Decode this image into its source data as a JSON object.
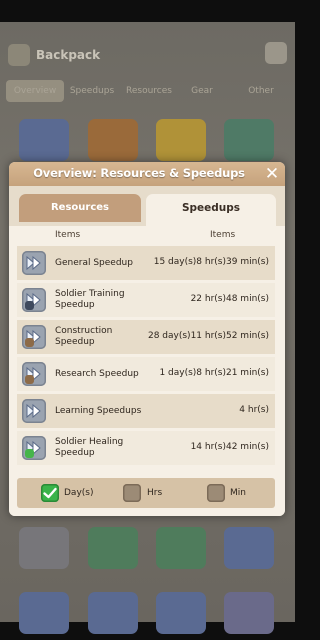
{
  "background": {
    "title": "Backpack",
    "tabs": [
      "Overview",
      "Speedups",
      "Resources",
      "Gear",
      "Other"
    ]
  },
  "modal": {
    "title": "Overview: Resources & Speedups",
    "close_glyph": "✕",
    "tabs": [
      {
        "label": "Resources",
        "active": false
      },
      {
        "label": "Speedups",
        "active": true
      }
    ],
    "columns": [
      "Items",
      "Items"
    ],
    "rows": [
      {
        "name": "General Speedup",
        "time": "15 day(s)8 hr(s)39 min(s)",
        "icon": "speedup-arrows-icon",
        "badge": "none"
      },
      {
        "name": "Soldier Training Speedup",
        "time": "22 hr(s)48 min(s)",
        "icon": "training-speedup-icon",
        "badge": "soldier"
      },
      {
        "name": "Construction Speedup",
        "time": "28 day(s)11 hr(s)52 min(s)",
        "icon": "construction-speedup-icon",
        "badge": "hammer"
      },
      {
        "name": "Research Speedup",
        "time": "1 day(s)8 hr(s)21 min(s)",
        "icon": "research-speedup-icon",
        "badge": "scroll"
      },
      {
        "name": "Learning Speedups",
        "time": "4 hr(s)",
        "icon": "learning-speedup-icon",
        "badge": "none"
      },
      {
        "name": "Soldier Healing Speedup",
        "time": "14 hr(s)42 min(s)",
        "icon": "healing-speedup-icon",
        "badge": "plus"
      }
    ],
    "footer": {
      "options": [
        {
          "label": "Day(s)",
          "checked": true
        },
        {
          "label": "Hrs",
          "checked": false
        },
        {
          "label": "Min",
          "checked": false
        }
      ]
    }
  }
}
